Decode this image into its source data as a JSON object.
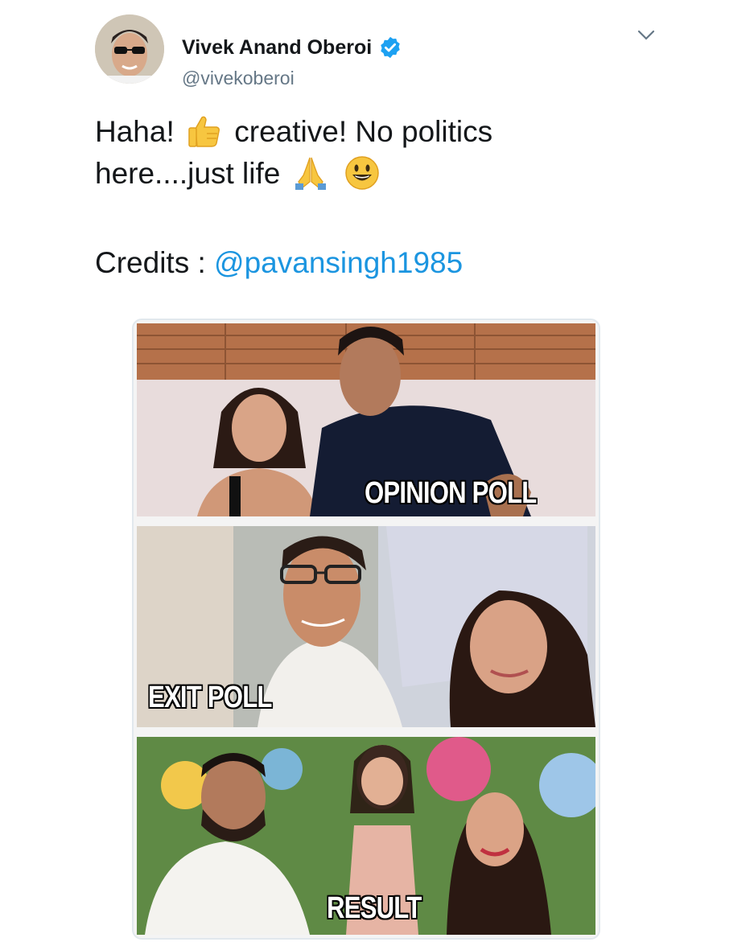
{
  "tweet": {
    "author": {
      "display_name": "Vivek Anand Oberoi",
      "handle": "@vivekoberoi",
      "verified": true
    },
    "text_line1_a": "Haha!",
    "text_line1_b": "creative! No politics",
    "text_line2": "here....just life",
    "emojis": [
      "thumbs-up-icon",
      "folded-hands-icon",
      "smiley-face-icon"
    ],
    "credits_label": "Credits :",
    "credits_mention": "@pavansingh1985"
  },
  "meme": {
    "panels": [
      {
        "caption": "OPINION POLL"
      },
      {
        "caption": "EXIT POLL"
      },
      {
        "caption": "RESULT"
      }
    ]
  },
  "colors": {
    "link": "#1b95e0",
    "verified": "#1da1f2",
    "handle": "#657786"
  }
}
